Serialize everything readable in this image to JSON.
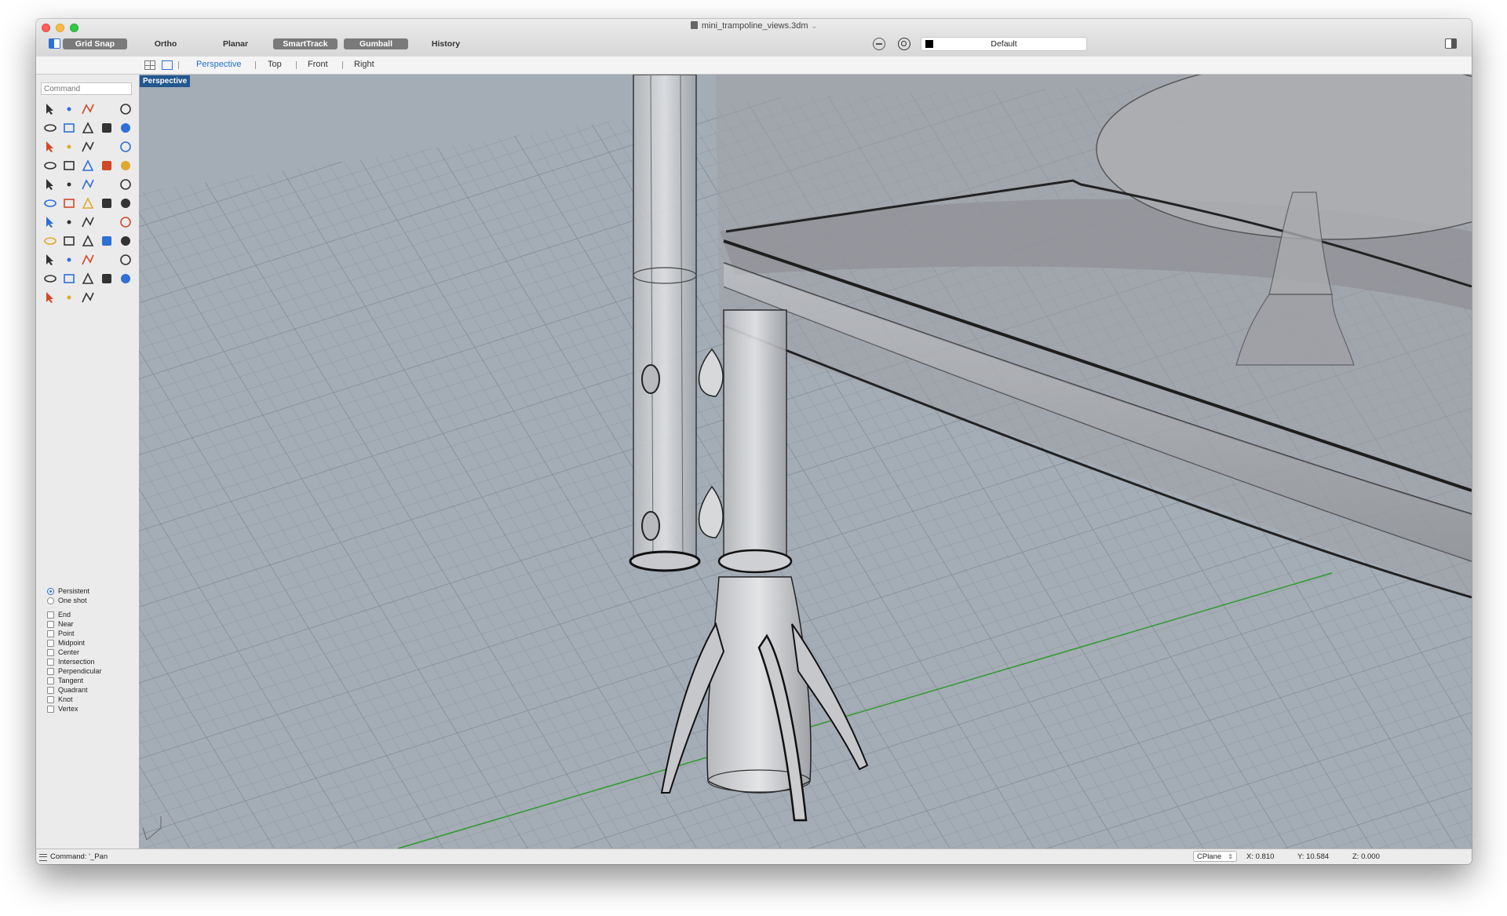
{
  "window": {
    "title": "mini_trampoline_views.3dm"
  },
  "toolbar": {
    "toggles": [
      {
        "label": "Grid Snap",
        "active": true
      },
      {
        "label": "Ortho",
        "active": false
      },
      {
        "label": "Planar",
        "active": false
      },
      {
        "label": "SmartTrack",
        "active": true
      },
      {
        "label": "Gumball",
        "active": true
      },
      {
        "label": "History",
        "active": false
      }
    ],
    "layer": {
      "name": "Default",
      "color": "#000000"
    }
  },
  "viewport_tabs": {
    "items": [
      "Perspective",
      "Top",
      "Front",
      "Right"
    ],
    "active": "Perspective"
  },
  "sidebar": {
    "command_placeholder": "Command"
  },
  "tool_icons": [
    "select-arrow-icon",
    "point-icon",
    "polyline-icon",
    "curve-icon",
    "circle-icon",
    "ellipse-icon",
    "polygon-icon",
    "rectangle-icon",
    "arc-icon",
    "fillet-curve-icon",
    "surface-icon",
    "extrude-surface-icon",
    "box-icon",
    "boolean-icon",
    "cylinder-icon",
    "plane-surface-icon",
    "explode-icon",
    "split-icon",
    "trim-icon",
    "text-icon",
    "text-object-icon",
    "group-icon",
    "curve-tool-icon",
    "revolve-icon",
    "dimension-icon",
    "move-icon",
    "array-icon",
    "transform-icon",
    "solid-tool-icon",
    "ruler-icon",
    "grid-icon",
    "mesh-icon",
    "analyze-icon",
    "checkmark-icon",
    "polygon-count-icon",
    "hatch-icon",
    "zoom-icon",
    "zoom-window-icon",
    "zoom-extents-icon",
    "search-icon",
    "pan-icon",
    "car-icon",
    "control-points-icon",
    "nodes-icon",
    "light-icon",
    "lock-icon",
    "layer-icon",
    "color-wheel-icon",
    "sphere-icon",
    "gear-icon",
    "render-icon",
    "marker-icon",
    "block-icon"
  ],
  "osnap": {
    "modes": [
      "Persistent",
      "One shot"
    ],
    "selected_mode": "Persistent",
    "snaps": [
      "End",
      "Near",
      "Point",
      "Midpoint",
      "Center",
      "Intersection",
      "Perpendicular",
      "Tangent",
      "Quadrant",
      "Knot",
      "Vertex"
    ]
  },
  "viewport": {
    "label": "Perspective",
    "background": "#9ba3ad"
  },
  "status": {
    "command": "Command: '_Pan",
    "cplane": "CPlane",
    "x": "X: 0.810",
    "y": "Y: 10.584",
    "z": "Z: 0.000"
  }
}
